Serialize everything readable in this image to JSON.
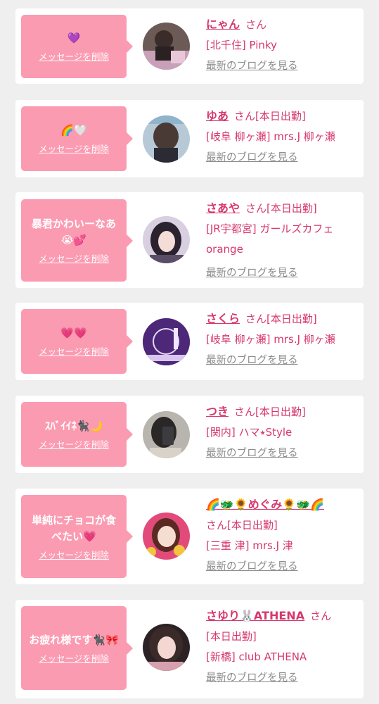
{
  "colors": {
    "bubble": "#fb9bb1",
    "accent": "#d6376e",
    "link_gray": "#8c8c8c"
  },
  "items": [
    {
      "message": "💜",
      "delete_label": "メッセージを削除",
      "name": "にゃん",
      "san": "さん",
      "status": "",
      "location": "[北千住] Pinky",
      "blog_label": "最新のブログを見る"
    },
    {
      "message": "🌈🤍",
      "delete_label": "メッセージを削除",
      "name": "ゆあ",
      "san": "さん",
      "status": "[本日出勤]",
      "location": "[岐阜 柳ヶ瀬] mrs.J 柳ヶ瀬",
      "blog_label": "最新のブログを見る"
    },
    {
      "message": "暴君かわいーなあ😭💕",
      "delete_label": "メッセージを削除",
      "name": "さあや",
      "san": "さん",
      "status": "[本日出勤]",
      "location": "[JR宇都宮] ガールズカフェ orange",
      "blog_label": "最新のブログを見る"
    },
    {
      "message": "💗💗",
      "delete_label": "メッセージを削除",
      "name": "さくら",
      "san": "さん",
      "status": "[本日出勤]",
      "location": "[岐阜 柳ヶ瀬] mrs.J 柳ヶ瀬",
      "blog_label": "最新のブログを見る"
    },
    {
      "message": "ｽﾊﾞｲｲﾈ🐈‍⬛🌙",
      "delete_label": "メッセージを削除",
      "name": "つき",
      "san": "さん",
      "status": "[本日出勤]",
      "location": "[関内] ハマ⭑Style",
      "blog_label": "最新のブログを見る"
    },
    {
      "message": "単純にチョコが食べたい💗",
      "delete_label": "メッセージを削除",
      "name": "🌈🐲🌻めぐみ🌻🐲🌈",
      "san": "さん",
      "status": "[本日出勤]",
      "location": "[三重 津] mrs.J 津",
      "blog_label": "最新のブログを見る"
    },
    {
      "message": "お疲れ様です🐈‍⬛🎀",
      "delete_label": "メッセージを削除",
      "name": "さゆり🐰ATHENA",
      "san": "さん",
      "status": "[本日出勤]",
      "location": "[新橋] club ATHENA",
      "blog_label": "最新のブログを見る"
    }
  ]
}
